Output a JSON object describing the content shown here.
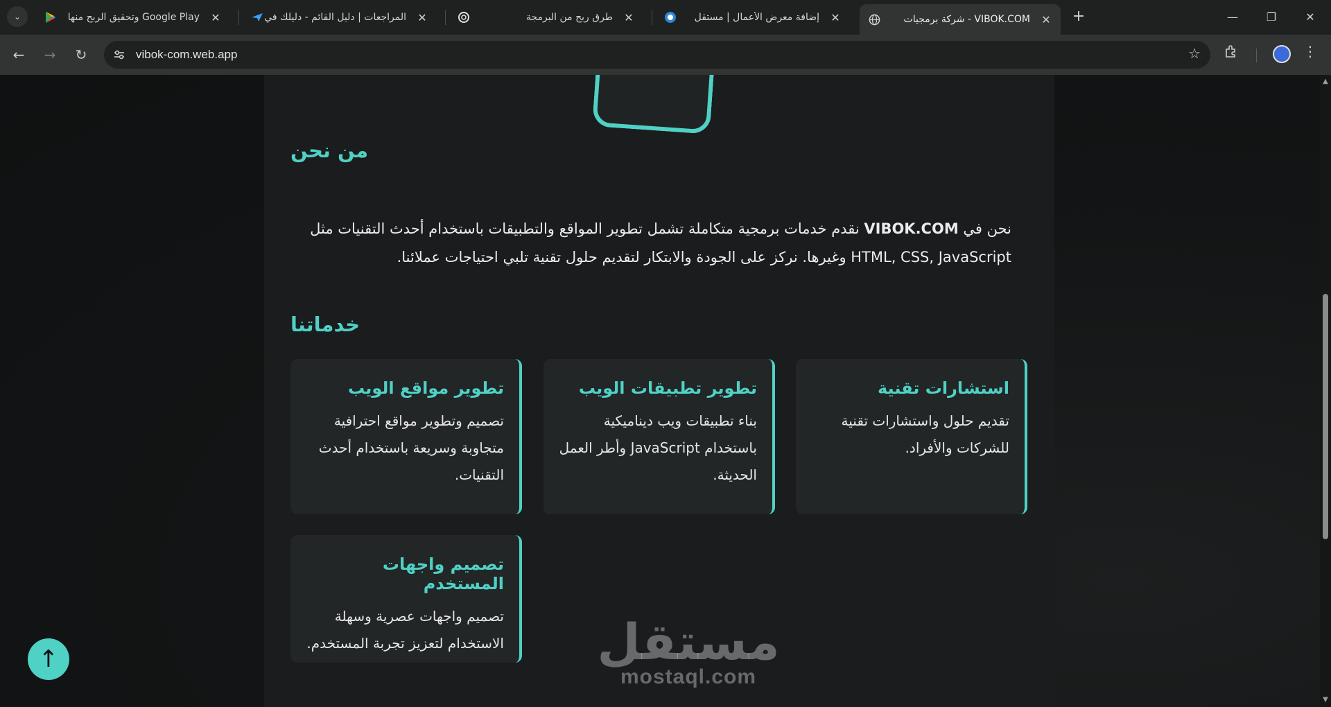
{
  "browser": {
    "tabs": [
      {
        "title": "Google Play وتحقيق الربح منها",
        "close": "✕"
      },
      {
        "title": "المراجعات | دليل القائم - دليلك في",
        "close": "✕"
      },
      {
        "title": "طرق ربح من البرمجة",
        "close": "✕"
      },
      {
        "title": "إضافة معرض الأعمال | مستقل",
        "close": "✕"
      },
      {
        "title": "VIBOK.COM - شركة برمجيات",
        "close": "✕"
      }
    ],
    "new_tab": "+",
    "url": "vibok-com.web.app"
  },
  "page": {
    "about_title": "من نحن",
    "about_text_brand": "VIBOK.COM",
    "about_text_prefix": "نحن في ",
    "about_text_body": " نقدم خدمات برمجية متكاملة تشمل تطوير المواقع والتطبيقات باستخدام أحدث التقنيات مثل HTML, CSS, JavaScript وغيرها. نركز على الجودة والابتكار لتقديم حلول تقنية تلبي احتياجات عملائنا.",
    "services_title": "خدماتنا",
    "services": [
      {
        "title": "استشارات تقنية",
        "desc": "تقديم حلول واستشارات تقنية للشركات والأفراد."
      },
      {
        "title": "تطوير تطبيقات الويب",
        "desc": "بناء تطبيقات ويب ديناميكية باستخدام JavaScript وأطر العمل الحديثة."
      },
      {
        "title": "تطوير مواقع الويب",
        "desc": "تصميم وتطوير مواقع احترافية متجاوبة وسريعة باستخدام أحدث التقنيات."
      },
      {
        "title": "تصميم واجهات المستخدم",
        "desc": "تصميم واجهات عصرية وسهلة الاستخدام لتعزيز تجربة المستخدم."
      }
    ],
    "back_to_top": "↑"
  },
  "watermark": {
    "arabic": "مستقل",
    "latin": "mostaql.com"
  },
  "colors": {
    "accent": "#4fd1c5",
    "card_bg": "#222627",
    "container_bg": "#1a1c1d"
  }
}
